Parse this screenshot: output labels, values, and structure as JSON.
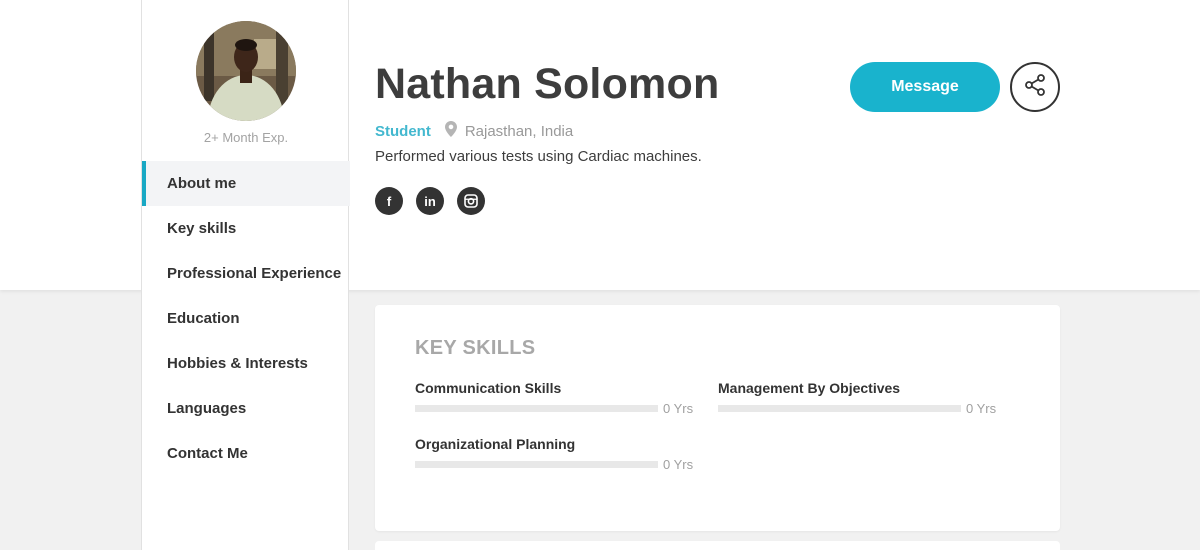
{
  "profile": {
    "name": "Nathan Solomon",
    "experience": "2+ Month Exp.",
    "role": "Student",
    "location": "Rajasthan, India",
    "description": "Performed various tests using Cardiac machines."
  },
  "nav": {
    "items": [
      {
        "label": "About me",
        "active": true
      },
      {
        "label": "Key skills"
      },
      {
        "label": "Professional Experience"
      },
      {
        "label": "Education"
      },
      {
        "label": "Hobbies & Interests"
      },
      {
        "label": "Languages"
      },
      {
        "label": "Contact Me"
      }
    ]
  },
  "social": [
    {
      "icon": "facebook-icon",
      "glyph": "f"
    },
    {
      "icon": "linkedin-icon",
      "glyph": "in"
    },
    {
      "icon": "instagram-icon",
      "glyph": ""
    }
  ],
  "actions": {
    "message_label": "Message",
    "share_icon": "share-icon"
  },
  "key_skills": {
    "title": "KEY SKILLS",
    "skills": [
      {
        "name": "Communication Skills",
        "years": "0 Yrs",
        "level": 0
      },
      {
        "name": "Management By Objectives",
        "years": "0 Yrs",
        "level": 0
      },
      {
        "name": "Organizational Planning",
        "years": "0 Yrs",
        "level": 0
      }
    ]
  },
  "colors": {
    "accent": "#19b3cd",
    "text": "#3d3d3d",
    "muted": "#a3a3a3",
    "background": "#f1f1f1"
  }
}
